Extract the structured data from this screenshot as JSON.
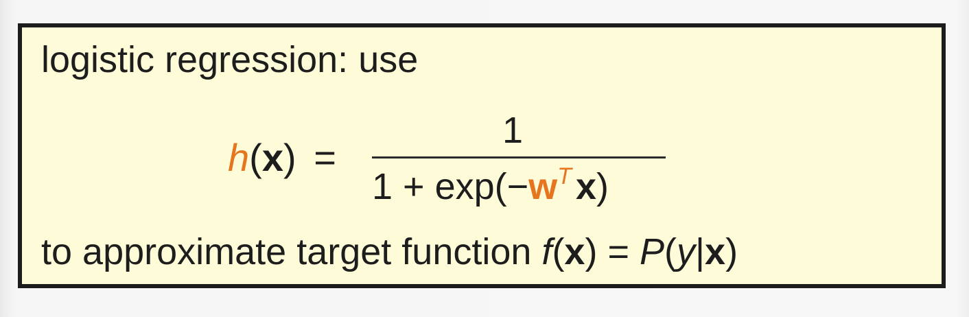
{
  "intro_text": "logistic regression: use",
  "formula": {
    "lhs_func": "h",
    "lhs_open": "(",
    "lhs_var": "x",
    "lhs_close": ")",
    "equals": "=",
    "numerator": "1",
    "den_prefix": "1 + exp(−",
    "den_weight": "w",
    "den_transpose": "T",
    "den_var": "x",
    "den_suffix": ")"
  },
  "outro": {
    "text": "to approximate target function ",
    "func": "f",
    "open1": "(",
    "var1": "x",
    "close1": ")",
    "equals": " = ",
    "prob": "P",
    "open2": "(",
    "y": "y",
    "bar": "|",
    "var2": "x",
    "close2": ")"
  },
  "colors": {
    "box_background": "#fdfbd8",
    "box_border": "#1c1c1c",
    "accent": "#e5761f",
    "text": "#1d1d1d"
  }
}
